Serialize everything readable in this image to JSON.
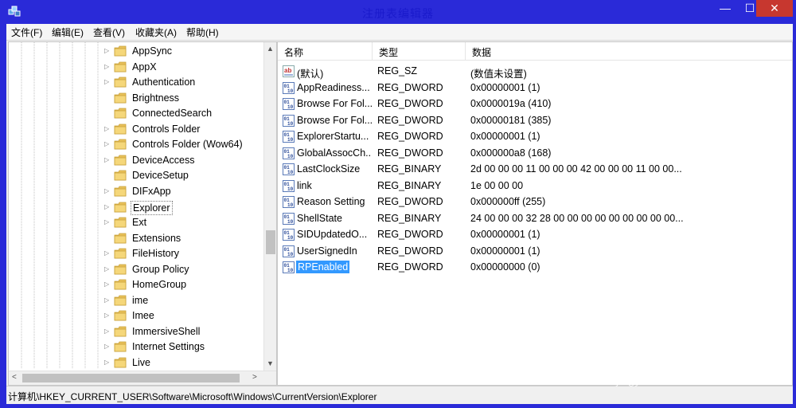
{
  "window": {
    "title": "注册表编辑器"
  },
  "controls": {
    "minimize": "—",
    "maximize": "☐",
    "close": "✕"
  },
  "menu": [
    "文件(F)",
    "编辑(E)",
    "查看(V)",
    "收藏夹(A)",
    "帮助(H)"
  ],
  "tree": {
    "items": [
      {
        "label": "AppSync",
        "expandable": true
      },
      {
        "label": "AppX",
        "expandable": true
      },
      {
        "label": "Authentication",
        "expandable": true
      },
      {
        "label": "Brightness",
        "expandable": false
      },
      {
        "label": "ConnectedSearch",
        "expandable": false
      },
      {
        "label": "Controls Folder",
        "expandable": true
      },
      {
        "label": "Controls Folder (Wow64)",
        "expandable": true
      },
      {
        "label": "DeviceAccess",
        "expandable": true
      },
      {
        "label": "DeviceSetup",
        "expandable": false
      },
      {
        "label": "DIFxApp",
        "expandable": true
      },
      {
        "label": "Explorer",
        "expandable": true,
        "selected": true
      },
      {
        "label": "Ext",
        "expandable": true
      },
      {
        "label": "Extensions",
        "expandable": false
      },
      {
        "label": "FileHistory",
        "expandable": true
      },
      {
        "label": "Group Policy",
        "expandable": true
      },
      {
        "label": "HomeGroup",
        "expandable": true
      },
      {
        "label": "ime",
        "expandable": true
      },
      {
        "label": "Imee",
        "expandable": true
      },
      {
        "label": "ImmersiveShell",
        "expandable": true
      },
      {
        "label": "Internet Settings",
        "expandable": true
      },
      {
        "label": "Live",
        "expandable": true
      }
    ]
  },
  "columns": {
    "name": "名称",
    "type": "类型",
    "data": "数据"
  },
  "values": [
    {
      "icon": "string-value-icon",
      "name": "(默认)",
      "type": "REG_SZ",
      "data": "(数值未设置)"
    },
    {
      "icon": "binary-value-icon",
      "name": "AppReadiness...",
      "type": "REG_DWORD",
      "data": "0x00000001 (1)"
    },
    {
      "icon": "binary-value-icon",
      "name": "Browse For Fol...",
      "type": "REG_DWORD",
      "data": "0x0000019a (410)"
    },
    {
      "icon": "binary-value-icon",
      "name": "Browse For Fol...",
      "type": "REG_DWORD",
      "data": "0x00000181 (385)"
    },
    {
      "icon": "binary-value-icon",
      "name": "ExplorerStartu...",
      "type": "REG_DWORD",
      "data": "0x00000001 (1)"
    },
    {
      "icon": "binary-value-icon",
      "name": "GlobalAssocCh...",
      "type": "REG_DWORD",
      "data": "0x000000a8 (168)"
    },
    {
      "icon": "binary-value-icon",
      "name": "LastClockSize",
      "type": "REG_BINARY",
      "data": "2d 00 00 00 11 00 00 00 42 00 00 00 11 00 00..."
    },
    {
      "icon": "binary-value-icon",
      "name": "link",
      "type": "REG_BINARY",
      "data": "1e 00 00 00"
    },
    {
      "icon": "binary-value-icon",
      "name": "Reason Setting",
      "type": "REG_DWORD",
      "data": "0x000000ff (255)"
    },
    {
      "icon": "binary-value-icon",
      "name": "ShellState",
      "type": "REG_BINARY",
      "data": "24 00 00 00 32 28 00 00 00 00 00 00 00 00 00..."
    },
    {
      "icon": "binary-value-icon",
      "name": "SIDUpdatedO...",
      "type": "REG_DWORD",
      "data": "0x00000001 (1)"
    },
    {
      "icon": "binary-value-icon",
      "name": "UserSignedIn",
      "type": "REG_DWORD",
      "data": "0x00000001 (1)"
    },
    {
      "icon": "binary-value-icon",
      "name": "RPEnabled",
      "type": "REG_DWORD",
      "data": "0x00000000 (0)",
      "selected": true
    }
  ],
  "status": {
    "path": "计算机\\HKEY_CURRENT_USER\\Software\\Microsoft\\Windows\\CurrentVersion\\Explorer"
  },
  "watermark": {
    "brand": "Baidu",
    "cn": "经验",
    "url": "jingyan.baidu.com"
  }
}
